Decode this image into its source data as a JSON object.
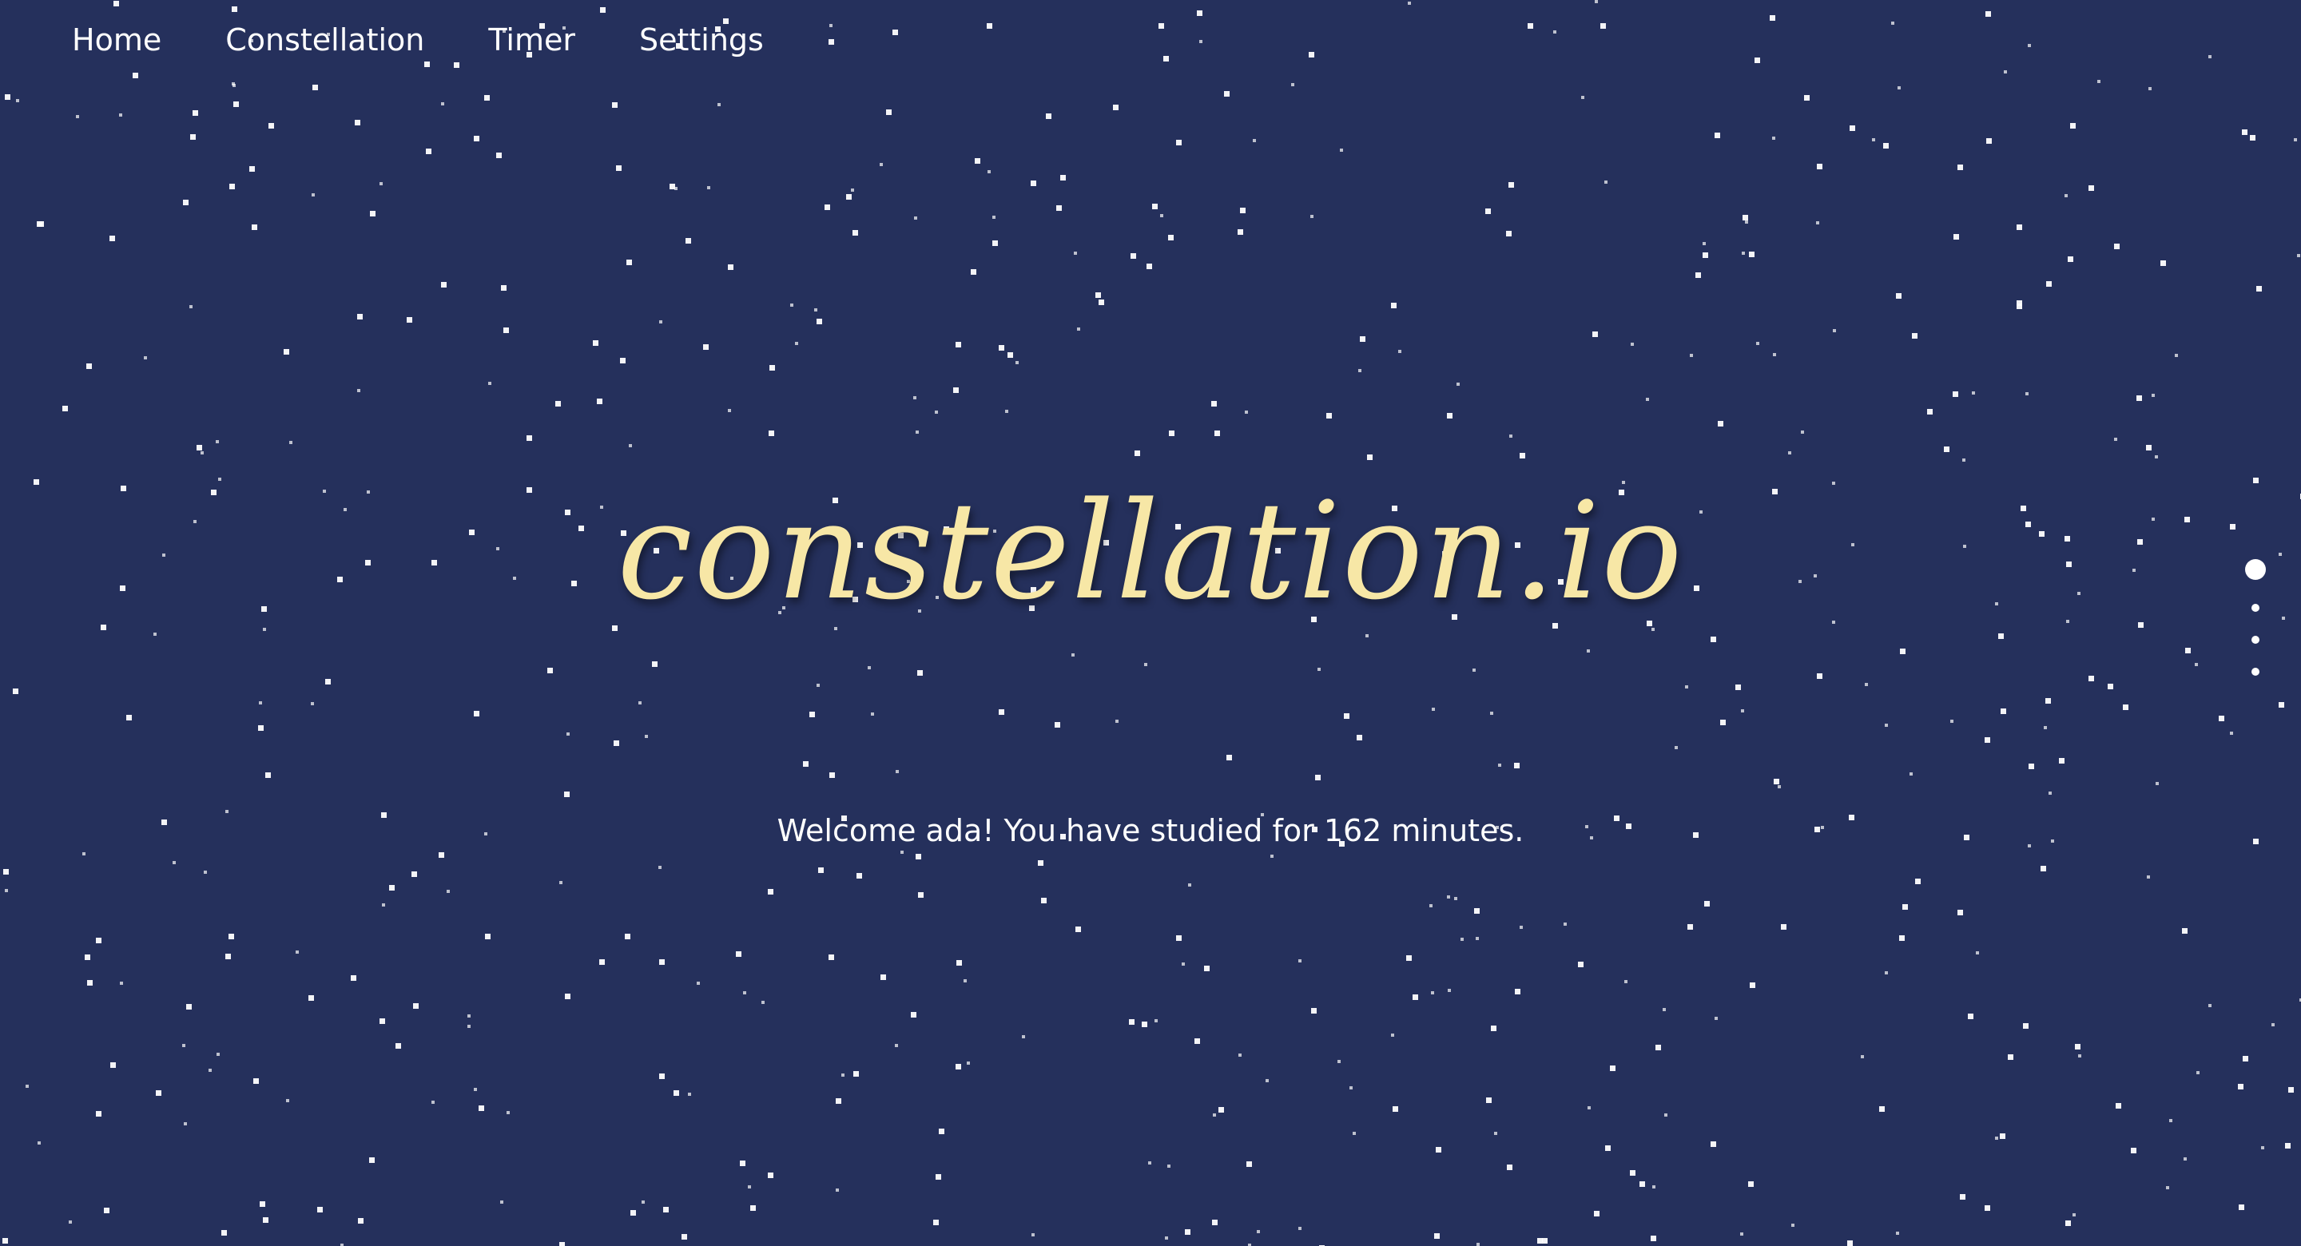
{
  "nav": {
    "items": [
      {
        "label": "Home"
      },
      {
        "label": "Constellation"
      },
      {
        "label": "Timer"
      },
      {
        "label": "Settings"
      }
    ]
  },
  "hero": {
    "title": "constellation.io",
    "welcome": "Welcome ada! You have studied for 162 minutes."
  },
  "pager": {
    "count": 4,
    "active_index": 0
  },
  "colors": {
    "background": "#25305c",
    "title": "#f7e7a6",
    "text": "#ffffff",
    "star": "#ffffff"
  }
}
